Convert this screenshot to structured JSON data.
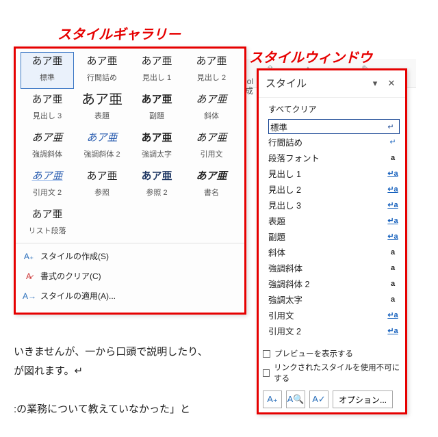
{
  "labels": {
    "gallery": "スタイルギャラリー",
    "window": "スタイルウィンドウ"
  },
  "gallery": {
    "items": [
      [
        {
          "prev": "あア亜",
          "name": "標準",
          "cls": "",
          "sel": true
        },
        {
          "prev": "あア亜",
          "name": "行間詰め",
          "cls": ""
        },
        {
          "prev": "あア亜",
          "name": "見出し 1",
          "cls": ""
        },
        {
          "prev": "あア亜",
          "name": "見出し 2",
          "cls": ""
        }
      ],
      [
        {
          "prev": "あア亜",
          "name": "見出し 3",
          "cls": ""
        },
        {
          "prev": "あア亜",
          "name": "表題",
          "cls": "big"
        },
        {
          "prev": "あア亜",
          "name": "副題",
          "cls": "bold"
        },
        {
          "prev": "あア亜",
          "name": "斜体",
          "cls": "italic"
        }
      ],
      [
        {
          "prev": "あア亜",
          "name": "強調斜体",
          "cls": "italic"
        },
        {
          "prev": "あア亜",
          "name": "強調斜体 2",
          "cls": "italic blue"
        },
        {
          "prev": "あア亜",
          "name": "強調太字",
          "cls": "bold"
        },
        {
          "prev": "あア亜",
          "name": "引用文",
          "cls": "italic"
        }
      ],
      [
        {
          "prev": "あア亜",
          "name": "引用文 2",
          "cls": "italic blue und"
        },
        {
          "prev": "あア亜",
          "name": "参照",
          "cls": ""
        },
        {
          "prev": "あア亜",
          "name": "参照 2",
          "cls": "bold dblue"
        },
        {
          "prev": "あア亜",
          "name": "書名",
          "cls": "bold italic"
        }
      ],
      [
        {
          "prev": "あア亜",
          "name": "リスト段落",
          "cls": ""
        }
      ]
    ],
    "menu": {
      "create": "スタイルの作成(S)",
      "clear": "書式のクリア(C)",
      "apply": "スタイルの適用(A)..."
    }
  },
  "swin": {
    "title": "スタイル",
    "clear_all": "すべてクリア",
    "items": [
      {
        "name": "標準",
        "tag": "↵",
        "tcls": "tg-para",
        "sel": true
      },
      {
        "name": "行間詰め",
        "tag": "↵",
        "tcls": "tg-para"
      },
      {
        "name": "段落フォント",
        "tag": "a",
        "tcls": "tg-a"
      },
      {
        "name": "見出し 1",
        "tag": "↵a",
        "tcls": "tg-pa"
      },
      {
        "name": "見出し 2",
        "tag": "↵a",
        "tcls": "tg-pa"
      },
      {
        "name": "見出し 3",
        "tag": "↵a",
        "tcls": "tg-pa"
      },
      {
        "name": "表題",
        "tag": "↵a",
        "tcls": "tg-pa"
      },
      {
        "name": "副題",
        "tag": "↵a",
        "tcls": "tg-pa"
      },
      {
        "name": "斜体",
        "tag": "a",
        "tcls": "tg-a"
      },
      {
        "name": "強調斜体",
        "tag": "a",
        "tcls": "tg-a"
      },
      {
        "name": "強調斜体 2",
        "tag": "a",
        "tcls": "tg-a"
      },
      {
        "name": "強調太字",
        "tag": "a",
        "tcls": "tg-a"
      },
      {
        "name": "引用文",
        "tag": "↵a",
        "tcls": "tg-pa"
      },
      {
        "name": "引用文 2",
        "tag": "↵a",
        "tcls": "tg-pa"
      }
    ],
    "chk_preview": "プレビューを表示する",
    "chk_linked": "リンクされたスタイルを使用不可にする",
    "options": "オプション..."
  },
  "doc": {
    "line1": "いきませんが、一から口頭で説明したり、",
    "line2": "が図れます。↵",
    "line3": ":の業務について教えていなかった」と"
  },
  "adobe": {
    "l1": "Adol",
    "l2": "作成"
  }
}
